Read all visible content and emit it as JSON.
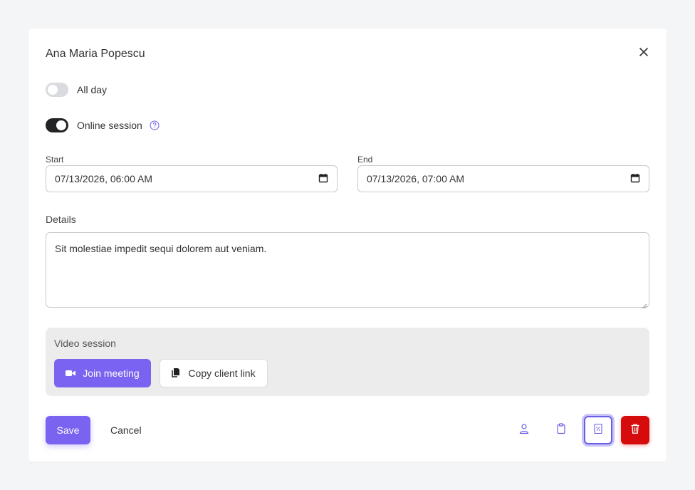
{
  "modal": {
    "title": "Ana Maria Popescu",
    "close_icon": "close-icon"
  },
  "toggles": {
    "all_day": {
      "label": "All day",
      "on": false
    },
    "online_session": {
      "label": "Online session",
      "on": true,
      "help_icon": "help-circle-icon"
    }
  },
  "start": {
    "label": "Start",
    "value": "07/13/2026, 06:00 AM"
  },
  "end": {
    "label": "End",
    "value": "07/13/2026, 07:00 AM"
  },
  "details": {
    "label": "Details",
    "value": "Sit molestiae impedit sequi dolorem aut veniam."
  },
  "video_session": {
    "label": "Video session",
    "join_label": "Join meeting",
    "copy_label": "Copy client link"
  },
  "footer": {
    "save_label": "Save",
    "cancel_label": "Cancel",
    "icons": [
      "user-icon",
      "clipboard-icon",
      "receipt-icon",
      "trash-icon"
    ]
  },
  "colors": {
    "accent": "#7a63f0",
    "danger": "#d60b0b",
    "toggle_on": "#222325",
    "background": "#f4f5f7"
  }
}
